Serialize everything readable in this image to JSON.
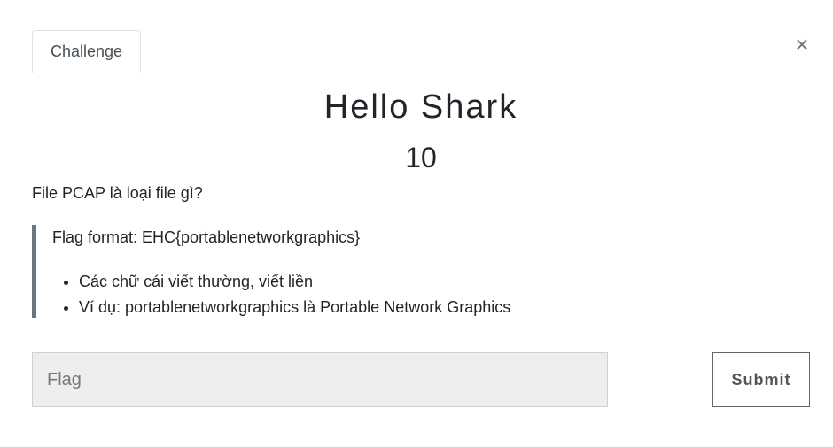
{
  "tabs": [
    {
      "label": "Challenge"
    }
  ],
  "close_label": "×",
  "challenge": {
    "name": "Hello Shark",
    "value": "10",
    "question": "File PCAP là loại file gì?",
    "flag_format": "Flag format: EHC{portablenetworkgraphics}",
    "hints": [
      "Các chữ cái viết thường, viết liền",
      "Ví dụ: portablenetworkgraphics là Portable Network Graphics"
    ]
  },
  "form": {
    "placeholder": "Flag",
    "value": "",
    "submit_label": "Submit"
  }
}
